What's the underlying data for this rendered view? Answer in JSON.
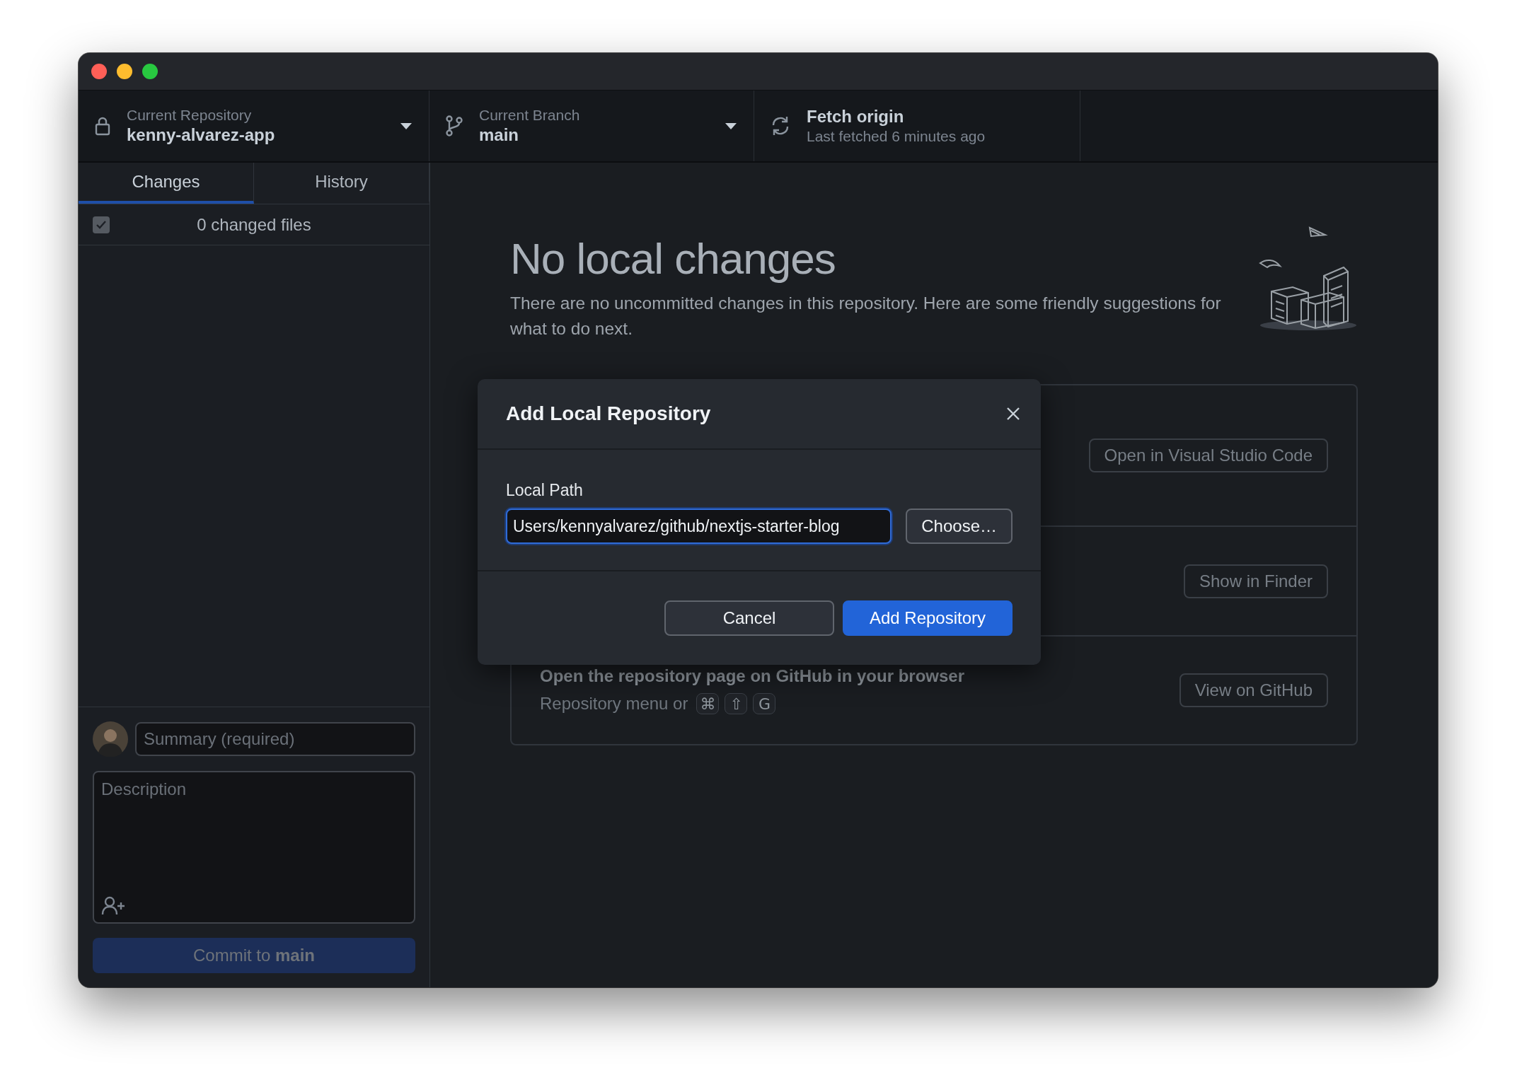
{
  "toolbar": {
    "repository": {
      "label": "Current Repository",
      "value": "kenny-alvarez-app"
    },
    "branch": {
      "label": "Current Branch",
      "value": "main"
    },
    "fetch": {
      "title": "Fetch origin",
      "subtitle": "Last fetched 6 minutes ago"
    }
  },
  "tabs": [
    {
      "label": "Changes",
      "selected": true
    },
    {
      "label": "History",
      "selected": false
    }
  ],
  "changes": {
    "select_all_checked": true,
    "count_label": "0 changed files"
  },
  "commit": {
    "summary_placeholder": "Summary (required)",
    "description_placeholder": "Description",
    "button_label": "Commit to **main**",
    "disabled": true
  },
  "main": {
    "title": "No local changes",
    "description": "There are no uncommitted changes in this repository. Here are some friendly suggestions for what to do next.",
    "suggestions": [
      {
        "button": "Open in Visual Studio Code"
      },
      {
        "button": "Show in Finder"
      },
      {
        "title": "Open the repository page on GitHub in your browser",
        "hint": "Repository menu or",
        "keys": [
          "⌘",
          "⇧",
          "G"
        ],
        "button": "View on GitHub"
      }
    ]
  },
  "dialog": {
    "title": "Add Local Repository",
    "field_label": "Local Path",
    "path_value": "Users/kennyalvarez/github/nextjs-starter-blog",
    "focused": true,
    "buttons": [
      {
        "label": "Choose…",
        "kind": "secondary"
      },
      {
        "label": "Cancel",
        "kind": "secondary"
      },
      {
        "label": "Add Repository",
        "kind": "primary"
      }
    ]
  }
}
